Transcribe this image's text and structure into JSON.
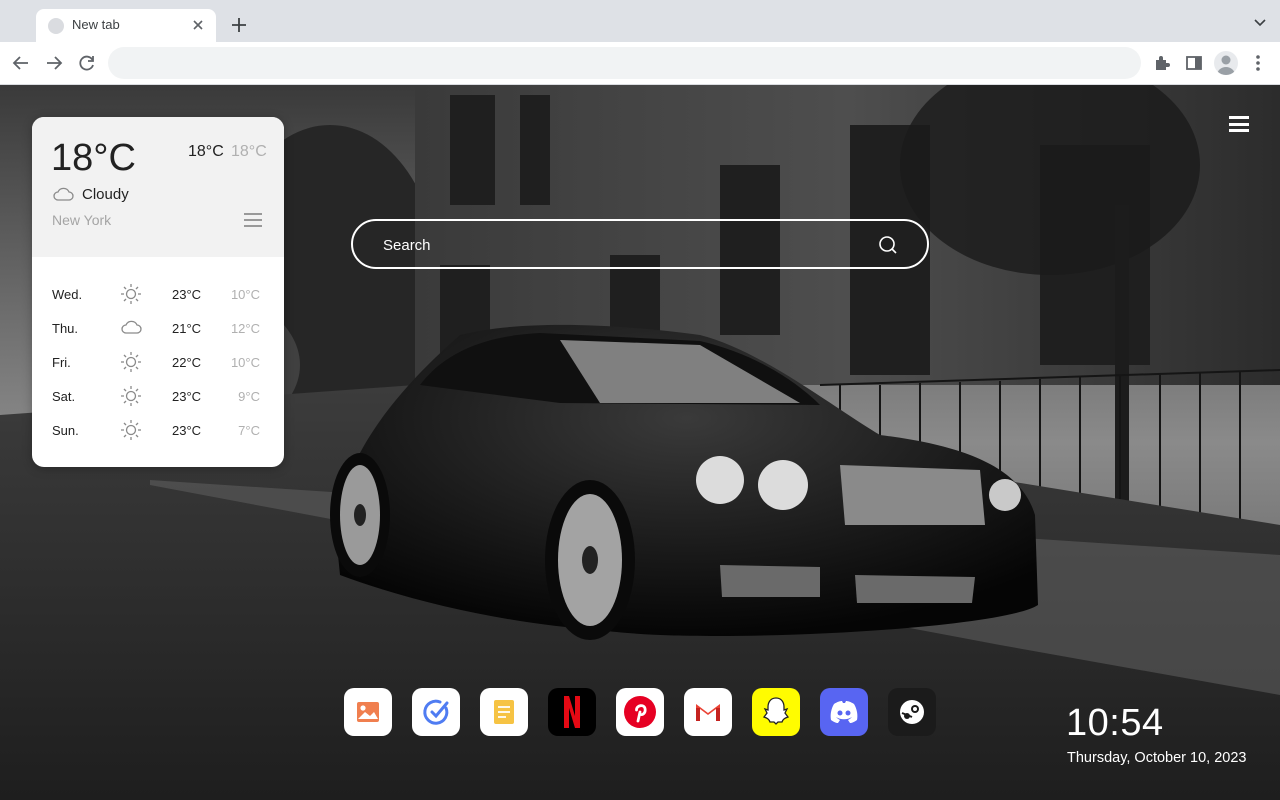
{
  "browser": {
    "tab_title": "New tab",
    "omnibox_value": ""
  },
  "weather": {
    "current_temp": "18°C",
    "high": "18°C",
    "low": "18°C",
    "condition": "Cloudy",
    "condition_icon": "cloud-icon",
    "city": "New York",
    "forecast": [
      {
        "day": "Wed.",
        "icon": "sun-icon",
        "high": "23°C",
        "low": "10°C"
      },
      {
        "day": "Thu.",
        "icon": "cloud-icon",
        "high": "21°C",
        "low": "12°C"
      },
      {
        "day": "Fri.",
        "icon": "sun-icon",
        "high": "22°C",
        "low": "10°C"
      },
      {
        "day": "Sat.",
        "icon": "sun-icon",
        "high": "23°C",
        "low": "9°C"
      },
      {
        "day": "Sun.",
        "icon": "sun-icon",
        "high": "23°C",
        "low": "7°C"
      }
    ]
  },
  "search": {
    "placeholder": "Search"
  },
  "dock": {
    "apps": [
      {
        "name": "Photos",
        "icon": "image-icon"
      },
      {
        "name": "Tasks",
        "icon": "check-icon"
      },
      {
        "name": "Notes",
        "icon": "note-icon"
      },
      {
        "name": "Netflix",
        "icon": "netflix-icon"
      },
      {
        "name": "Pinterest",
        "icon": "pinterest-icon"
      },
      {
        "name": "Gmail",
        "icon": "gmail-icon"
      },
      {
        "name": "Snapchat",
        "icon": "snapchat-icon"
      },
      {
        "name": "Discord",
        "icon": "discord-icon"
      },
      {
        "name": "Steam",
        "icon": "steam-icon"
      }
    ]
  },
  "clock": {
    "time": "10:54",
    "date": "Thursday, October 10, 2023"
  },
  "colors": {
    "netflix": "#000000",
    "netflix_red": "#e50914",
    "pinterest": "#e60023",
    "snapchat": "#fffc00",
    "discord": "#5865f2",
    "steam": "#1b1b1b"
  }
}
